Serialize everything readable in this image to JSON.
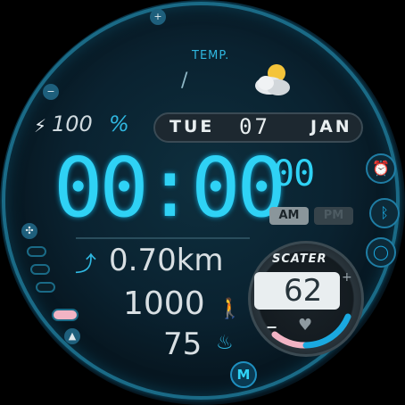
{
  "weather": {
    "label": "TEMP.",
    "value": "/",
    "icon": "partly-cloudy-icon"
  },
  "battery": {
    "icon": "bolt-icon",
    "value": "100",
    "unit": "%"
  },
  "date": {
    "day_of_week": "TUE",
    "day": "07",
    "month": "JAN"
  },
  "time": {
    "hours_minutes": "00:00",
    "seconds": "00",
    "am": "AM",
    "pm": "PM"
  },
  "activity": {
    "distance": "0.70km",
    "steps": "1000",
    "calories": "75"
  },
  "heart_rate": {
    "brand": "SCATER",
    "value": "62",
    "plus": "+",
    "minus": "−"
  },
  "controls": {
    "top_plus": "+",
    "top_minus": "−",
    "logo": "M"
  },
  "colors": {
    "accent": "#2fd2f5",
    "bezel": "#1a6a86",
    "background": "#0a2230"
  }
}
